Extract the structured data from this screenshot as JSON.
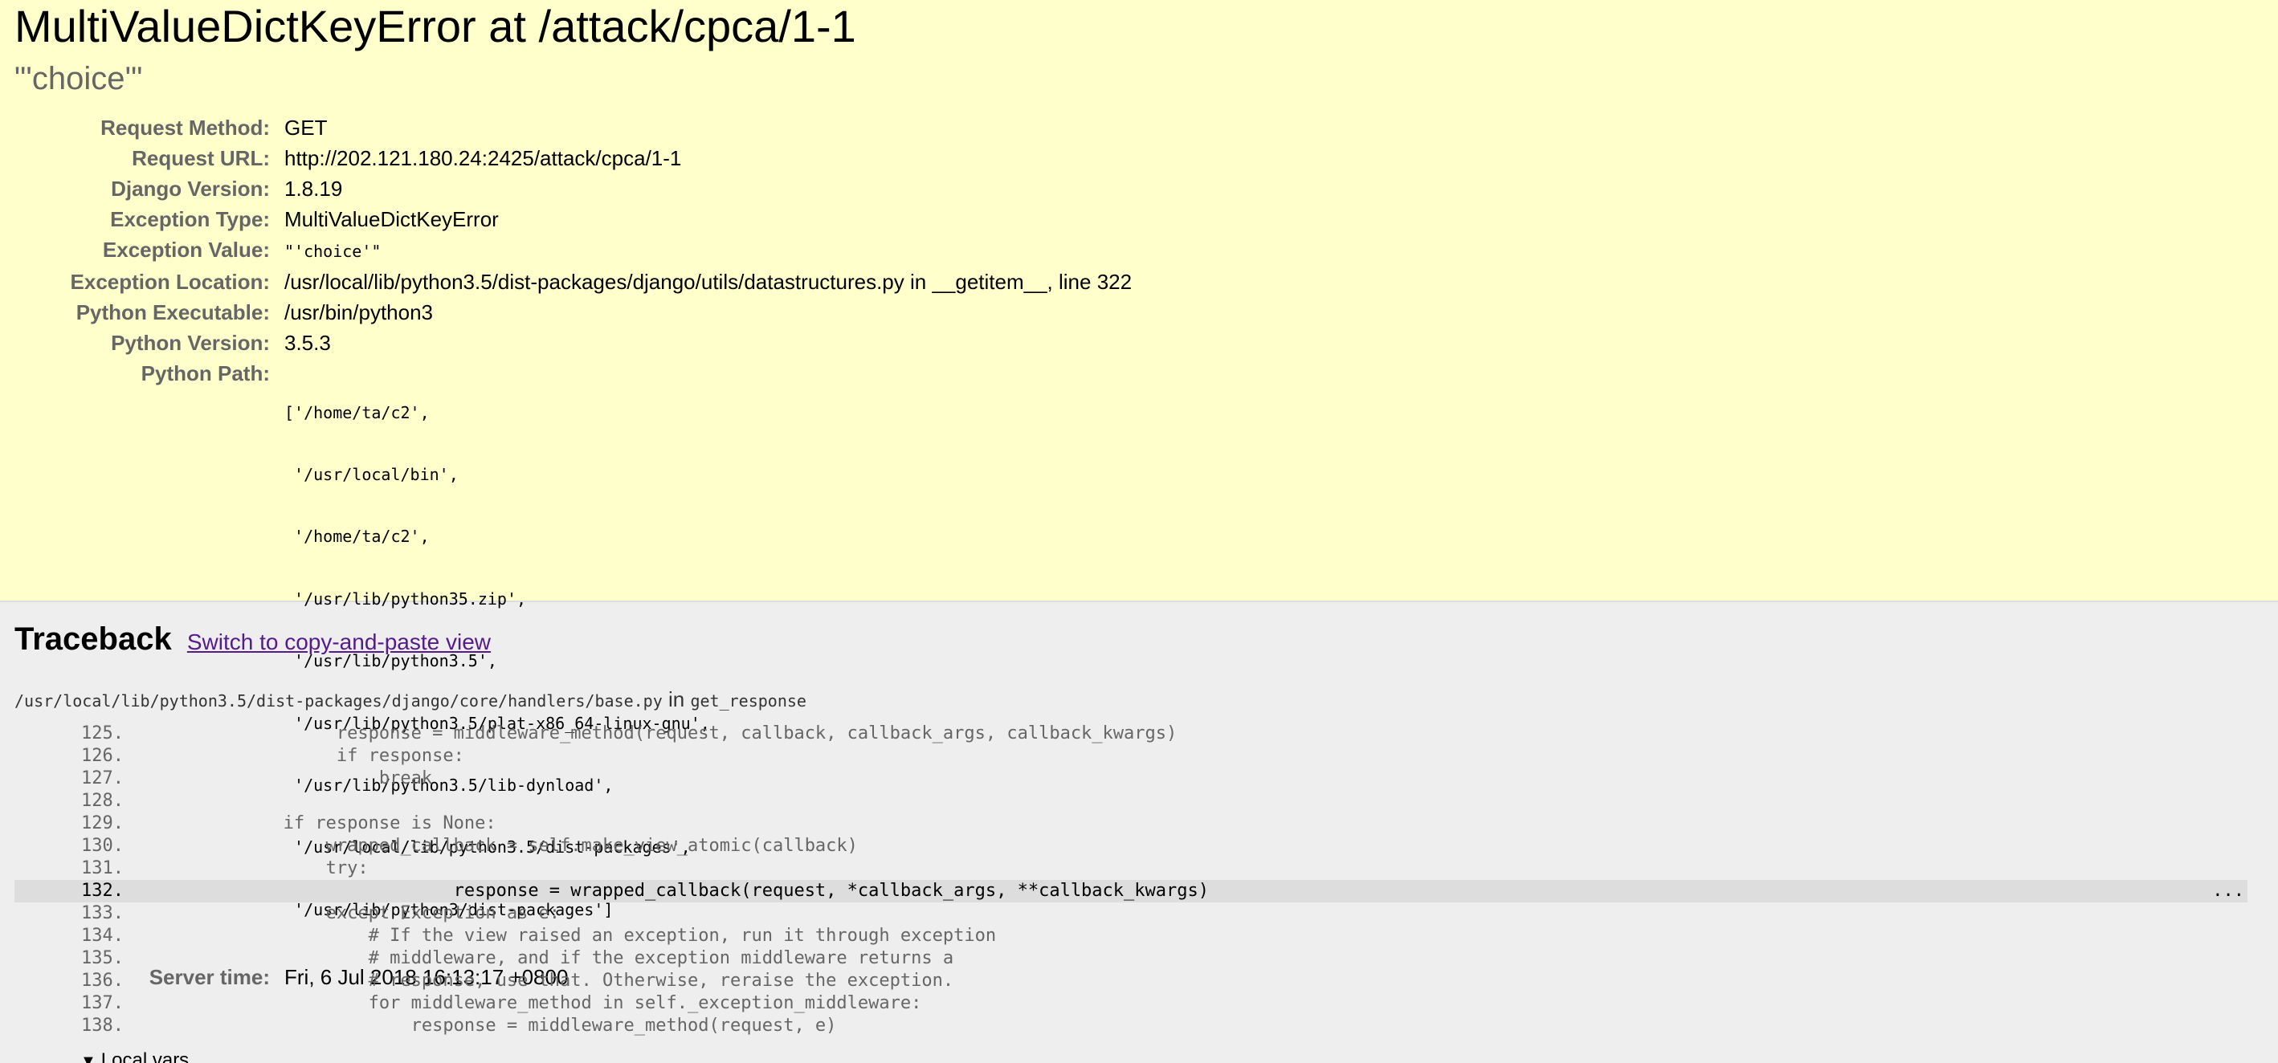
{
  "summary": {
    "title": "MultiValueDictKeyError at /attack/cpca/1-1",
    "exception_value_heading": "\"'choice'\"",
    "meta": [
      {
        "label": "Request Method:",
        "value": "GET"
      },
      {
        "label": "Request URL:",
        "value": "http://202.121.180.24:2425/attack/cpca/1-1"
      },
      {
        "label": "Django Version:",
        "value": "1.8.19"
      },
      {
        "label": "Exception Type:",
        "value": "MultiValueDictKeyError"
      },
      {
        "label": "Exception Value:",
        "value": "\"'choice'\""
      },
      {
        "label": "Exception Location:",
        "value": "/usr/local/lib/python3.5/dist-packages/django/utils/datastructures.py in __getitem__, line 322"
      },
      {
        "label": "Python Executable:",
        "value": "/usr/bin/python3"
      },
      {
        "label": "Python Version:",
        "value": "3.5.3"
      },
      {
        "label": "Python Path:",
        "value": ""
      },
      {
        "label": "Server time:",
        "value": "Fri, 6 Jul 2018 16:13:17 +0800"
      }
    ],
    "python_path": [
      "['/home/ta/c2',",
      " '/usr/local/bin',",
      " '/home/ta/c2',",
      " '/usr/lib/python35.zip',",
      " '/usr/lib/python3.5',",
      " '/usr/lib/python3.5/plat-x86_64-linux-gnu',",
      " '/usr/lib/python3.5/lib-dynload',",
      " '/usr/local/lib/python3.5/dist-packages',",
      " '/usr/lib/python3/dist-packages']"
    ]
  },
  "traceback": {
    "title": "Traceback",
    "switch_link": "Switch to copy-and-paste view",
    "frame": {
      "file": "/usr/local/lib/python3.5/dist-packages/django/core/handlers/base.py",
      "in_word": "in",
      "function": "get_response",
      "lines": [
        {
          "no": "125.",
          "code": "                    response = middleware_method(request, callback, callback_args, callback_kwargs)"
        },
        {
          "no": "126.",
          "code": "                    if response:"
        },
        {
          "no": "127.",
          "code": "                        break"
        },
        {
          "no": "128.",
          "code": ""
        },
        {
          "no": "129.",
          "code": "               if response is None:"
        },
        {
          "no": "130.",
          "code": "                   wrapped_callback = self.make_view_atomic(callback)"
        },
        {
          "no": "131.",
          "code": "                   try:"
        },
        {
          "no": "132.",
          "code": "                               response = wrapped_callback(request, *callback_args, **callback_kwargs)",
          "current": true,
          "ellipsis": "..."
        },
        {
          "no": "133.",
          "code": "                   except Exception as e:"
        },
        {
          "no": "134.",
          "code": "                       # If the view raised an exception, run it through exception"
        },
        {
          "no": "135.",
          "code": "                       # middleware, and if the exception middleware returns a"
        },
        {
          "no": "136.",
          "code": "                       # response, use that. Otherwise, reraise the exception."
        },
        {
          "no": "137.",
          "code": "                       for middleware_method in self._exception_middleware:"
        },
        {
          "no": "138.",
          "code": "                           response = middleware_method(request, e)"
        }
      ]
    },
    "local_vars_label": "Local vars",
    "local_vars_icon": "triangle-down-icon"
  }
}
